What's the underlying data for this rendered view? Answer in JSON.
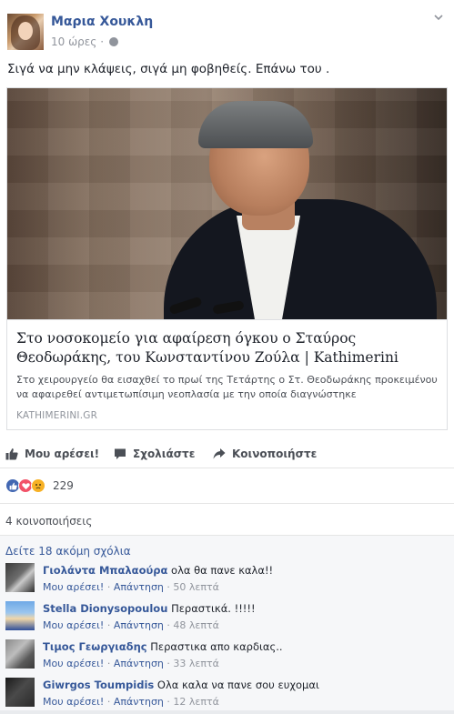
{
  "post": {
    "author": "Μαρια Χουκλη",
    "time": "10 ώρες",
    "text": "Σιγά να μην κλάψεις, σιγά μη φοβηθείς. Επάνω του ."
  },
  "link_card": {
    "title": "Στο νοσοκομείο για αφαίρεση όγκου ο Σταύρος Θεοδωράκης, του Κωνσταντίνου Ζούλα | Kathimerini",
    "description": "Στο χειρουργείο θα εισαχθεί το πρωί της Τετάρτης ο Στ. Θεοδωράκης προκειμένου να αφαιρεθεί αντιμετωπίσιμη νεοπλασία με την οποία διαγνώστηκε",
    "domain": "KATHIMERINI.GR"
  },
  "actions": {
    "like": "Μου αρέσει!",
    "comment": "Σχολιάστε",
    "share": "Κοινοποιήστε"
  },
  "reactions": {
    "count": "229",
    "types": [
      "like",
      "love",
      "sad"
    ]
  },
  "shares": "4 κοινοποιήσεις",
  "comments_header": "Δείτε 18 ακόμη σχόλια",
  "comments": [
    {
      "name": "Γιολάντα Μπαλαούρα",
      "text": "ολα θα πανε καλα!!",
      "like": "Μου αρέσει!",
      "reply": "Απάντηση",
      "time": "50 λεπτά"
    },
    {
      "name": "Stella Dionysopoulou",
      "text": "Περαστικά. !!!!!",
      "like": "Μου αρέσει!",
      "reply": "Απάντηση",
      "time": "48 λεπτά"
    },
    {
      "name": "Τιμος Γεωργιαδης",
      "text": "Περαστικα απο καρδιας..",
      "like": "Μου αρέσει!",
      "reply": "Απάντηση",
      "time": "33 λεπτά"
    },
    {
      "name": "Giwrgos Toumpidis",
      "text": "Ολα καλα να πανε σου ευχομαι",
      "like": "Μου αρέσει!",
      "reply": "Απάντηση",
      "time": "12 λεπτά"
    }
  ],
  "separator": "·",
  "colors": {
    "link_blue": "#365899",
    "meta_gray": "#90949c",
    "like_blue": "#4267b2"
  }
}
